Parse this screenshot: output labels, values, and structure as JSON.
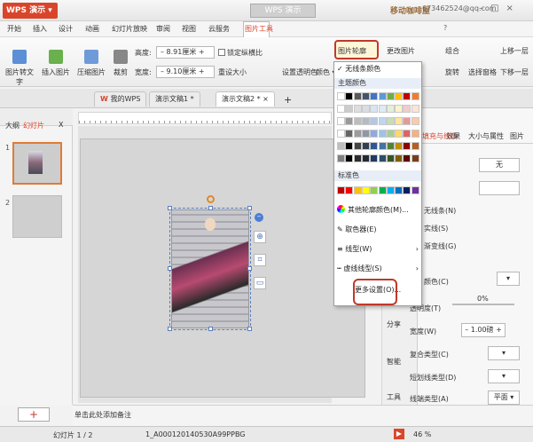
{
  "titlebar": {
    "app_name": "WPS 演示",
    "doc_title": "WPS 演示",
    "logo_text": "移动咖啡屋",
    "email": "673462524@qq.com"
  },
  "menu": [
    "开始",
    "插入",
    "设计",
    "动画",
    "幻灯片放映",
    "审阅",
    "视图",
    "云服务",
    "图片工具"
  ],
  "menu_right": "?",
  "ribbon": {
    "to_text": "图片转文字",
    "insert_image": "插入图片",
    "compress": "压缩图片",
    "crop": "裁剪",
    "height_label": "高度:",
    "height_value": "8.91厘米",
    "width_label": "宽度:",
    "width_value": "9.10厘米",
    "lock_ratio": "锁定纵横比",
    "reset_size": "重设大小",
    "set_transparent": "设置透明色",
    "color": "颜色",
    "outline": "图片轮廓",
    "change_image": "更改图片",
    "combine": "组合",
    "rotate": "旋转",
    "select_pane": "选择窗格",
    "up_layer": "上移一层",
    "down_layer": "下移一层"
  },
  "tabs": [
    "我的WPS",
    "演示文稿1 *",
    "演示文稿2 *"
  ],
  "left_panel": {
    "tab_outline": "大纲",
    "tab_slides": "幻灯片",
    "close": "X",
    "slide1": "1",
    "slide2": "2"
  },
  "notes_placeholder": "单击此处添加备注",
  "status": {
    "slide_count": "幻灯片 1 / 2",
    "theme": "1_A000120140530A99PPBG",
    "zoom": "46 %"
  },
  "right_panel": {
    "tabs": [
      "填充与线条",
      "效果",
      "大小与属性",
      "图片"
    ],
    "none": "无",
    "no_line": "无线条(N)",
    "solid_line": "实线(S)",
    "gradient_line": "渐变线(G)",
    "color_label": "颜色(C)",
    "transparency": "透明度(T)",
    "transparency_value": "0%",
    "width_label": "宽度(W)",
    "width_value": "1.00磅",
    "compound": "复合类型(C)",
    "dash": "短划线类型(D)",
    "cap": "线端类型(A)",
    "cap_value": "平面"
  },
  "side_strip": [
    "分享",
    "智能",
    "工具"
  ],
  "dropdown": {
    "no_line_color": "无线条颜色",
    "theme_colors": "主题颜色",
    "standard_colors": "标准色",
    "more_colors": "其他轮廓颜色(M)...",
    "eyedropper": "取色器(E)",
    "line_style": "线型(W)",
    "dash_style": "虚线线型(S)",
    "more_settings": "更多设置(O)..."
  },
  "colors": {
    "theme_row": [
      "#ffffff",
      "#000000",
      "#5a5a5a",
      "#44546a",
      "#4472c4",
      "#5b9bd5",
      "#70ad47",
      "#ffc000",
      "#c00000",
      "#ed7d31"
    ],
    "standard": [
      "#c00000",
      "#ff0000",
      "#ffc000",
      "#ffff00",
      "#92d050",
      "#00b050",
      "#00b0f0",
      "#0070c0",
      "#002060",
      "#7030a0"
    ],
    "accent": "#d9452b",
    "highlight": "#c0392b"
  }
}
